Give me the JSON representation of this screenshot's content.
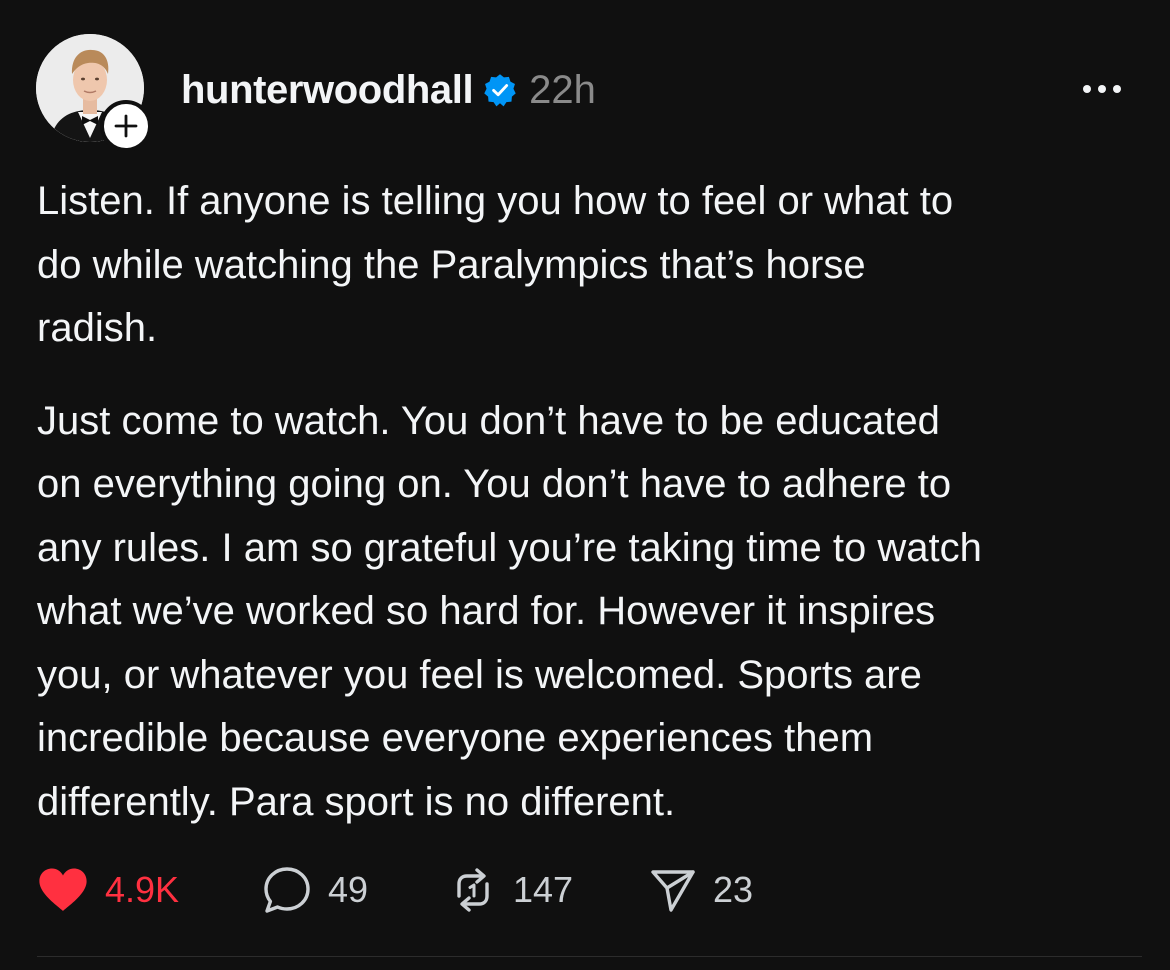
{
  "post": {
    "username": "hunterwoodhall",
    "timestamp": "22h",
    "paragraphs": [
      "Listen. If anyone is telling you how to feel or what to\ndo while watching the Paralympics that’s horse\nradish.",
      "Just come to watch. You don’t have to be educated\non everything going on. You don’t have to adhere to\nany rules. I am so grateful you’re taking time to watch\nwhat we’ve worked so hard for. However it inspires\nyou, or whatever you feel is welcomed. Sports are\nincredible because everyone experiences them\ndifferently. Para sport is no different."
    ],
    "icons": {
      "verified": "verified-badge-icon",
      "follow": "plus-icon",
      "more": "more-horizontal-icon"
    }
  },
  "actions": {
    "likes": "4.9K",
    "replies": "49",
    "reposts": "147",
    "shares": "23",
    "icons": [
      "heart-icon",
      "comment-icon",
      "repost-icon",
      "send-icon"
    ]
  },
  "colors": {
    "background": "#101010",
    "text": "#f3f5f7",
    "muted": "#8a8a8a",
    "like_red": "#ff3040",
    "verified_blue": "#0095f6"
  }
}
